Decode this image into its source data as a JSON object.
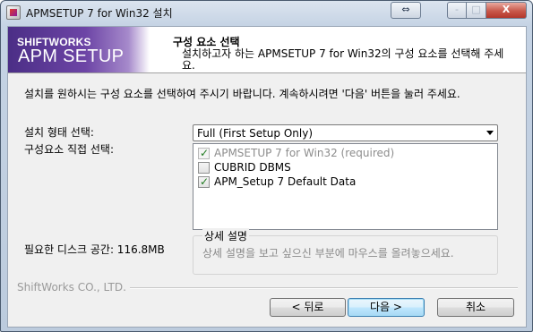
{
  "window": {
    "title": "APMSETUP 7 for Win32 설치",
    "close_symbol": "X",
    "minimize_symbol": "-",
    "maximize_symbol": "□"
  },
  "banner": {
    "brand_small": "SHIFTWORKS",
    "brand_big": "APM SETUP"
  },
  "header": {
    "title": "구성 요소 선택",
    "description": "설치하고자 하는 APMSETUP 7 for Win32의 구성 요소를 선택해 주세요."
  },
  "instruction": "설치를 원하시는 구성 요소를 선택하여 주시기 바랍니다. 계속하시려면 '다음' 버튼을 눌러 주세요.",
  "install_type": {
    "label": "설치 형태 선택:",
    "selected": "Full (First Setup Only)"
  },
  "components": {
    "label": "구성요소 직접 선택:",
    "items": [
      {
        "label": "APMSETUP 7 for Win32 (required)",
        "checked": true,
        "disabled": true
      },
      {
        "label": "CUBRID DBMS",
        "checked": false,
        "disabled": false
      },
      {
        "label": "APM_Setup 7 Default Data",
        "checked": true,
        "disabled": false
      }
    ]
  },
  "description_box": {
    "title": "상세 설명",
    "body": "상세 설명을 보고 싶으신 부분에 마우스를 올려놓으세요."
  },
  "space_required": "필요한 디스크 공간: 116.8MB",
  "company": "ShiftWorks CO., LTD.",
  "buttons": {
    "back": "< 뒤로",
    "next": "다음 >",
    "cancel": "취소"
  },
  "colors": {
    "banner_purple": "#5b3a96",
    "default_button_border": "#3c7fb1",
    "checkmark_green": "#1f7a1f"
  }
}
